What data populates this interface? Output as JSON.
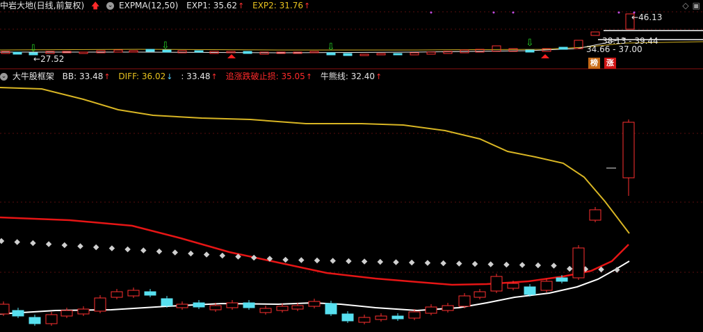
{
  "top_bar": {
    "stock_title": "中岩大地(日线,前复权)",
    "indicator": "EXPMA(12,50)",
    "exp1_label": "EXP1: 35.62",
    "exp2_label": "EXP2: 31.76"
  },
  "main_labels": {
    "high_price": "46.13",
    "low_price": "27.52",
    "range1": "38.13 - 39.44",
    "range2": "34.66 - 37.00",
    "badge1": "榜",
    "badge2": "涨"
  },
  "sub_bar": {
    "indicator_name": "大牛股框架",
    "bb_label": "BB: 33.48",
    "diff_label": "DIFF: 36.02",
    "third_label": ": 33.48",
    "stop_label": "追涨跌破止损: 35.05",
    "bear_label": "牛熊线: 32.40"
  },
  "colors": {
    "up": "#ff3030",
    "down": "#57e0f0",
    "yellow_line": "#d9b624",
    "red_line": "#e61515",
    "white_line": "#ffffff",
    "dots": "#cfcfcf"
  },
  "chart_data": {
    "type": "candlestick",
    "panels": [
      {
        "name": "main",
        "series": [
          {
            "name": "EXP1",
            "value": 35.62
          },
          {
            "name": "EXP2",
            "value": 31.76
          }
        ],
        "marks": {
          "high": 46.13,
          "low": 27.52
        }
      },
      {
        "name": "大牛股框架",
        "series": [
          {
            "name": "BB",
            "value": 33.48
          },
          {
            "name": "DIFF",
            "value": 36.02
          },
          {
            "name": "追涨跌破止损",
            "value": 35.05
          },
          {
            "name": "牛熊线",
            "value": 32.4
          }
        ]
      }
    ]
  }
}
